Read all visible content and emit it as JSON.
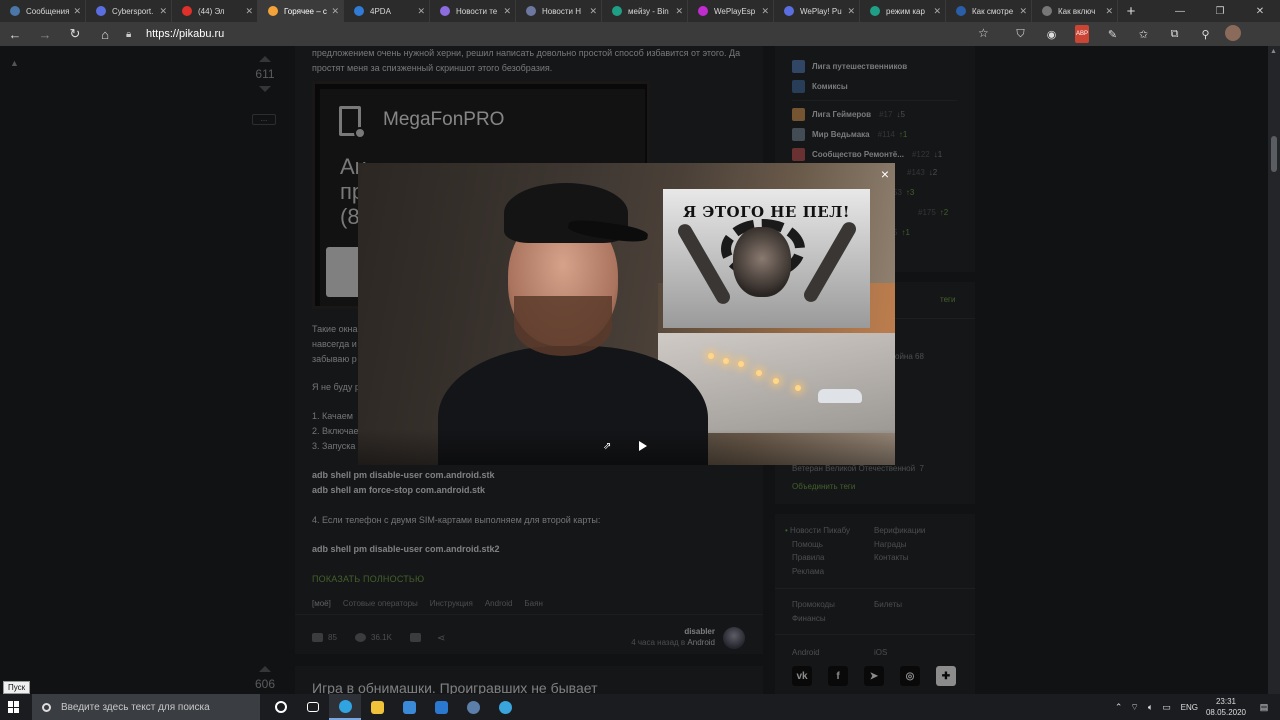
{
  "browser": {
    "tabs": [
      {
        "title": "Сообщения",
        "color": "#4a76a8",
        "active": false
      },
      {
        "title": "Cybersport.",
        "color": "#5b6ee0",
        "active": false
      },
      {
        "title": "(44) Эл",
        "color": "#e0302a",
        "active": false
      },
      {
        "title": "Горячее – с",
        "color": "#f4a23a",
        "active": true
      },
      {
        "title": "4PDA",
        "color": "#2f7bd6",
        "active": false
      },
      {
        "title": "Новости те",
        "color": "#8c6ce0",
        "active": false
      },
      {
        "title": "Новости Н",
        "color": "#6d78a0",
        "active": false
      },
      {
        "title": "мейзу - Bin",
        "color": "#1fa086",
        "active": false
      },
      {
        "title": "WePlayEsp",
        "color": "#c02cd0",
        "active": false
      },
      {
        "title": "WePlay! Pu",
        "color": "#5b6ee0",
        "active": false
      },
      {
        "title": "режим кар",
        "color": "#1fa086",
        "active": false
      },
      {
        "title": "Как смотре",
        "color": "#2a5ea8",
        "active": false
      },
      {
        "title": "Как включ",
        "color": "#777777",
        "active": false
      }
    ],
    "new_tab": "+",
    "url": "https://pikabu.ru"
  },
  "post": {
    "rating": "611",
    "lead": "предложением очень нужной херни, решил написать довольно простой способ избавится от этого. Да простят меня за спизженный скриншот этого безобразия.",
    "screenshot": {
      "app_name": "MegaFonPRO",
      "big_text": [
        "Ан",
        "пр",
        "(8"
      ]
    },
    "body_fragments": [
      "Такие окна",
      "навсегда и",
      "забываю р",
      "Я не буду р",
      "1. Качаем",
      "2. Включае",
      "3. Запуска"
    ],
    "cmd1": "adb shell pm disable-user com.android.stk",
    "cmd2": "adb shell am force-stop com.android.stk",
    "step4": "4. Если телефон с двумя SIM-картами выполняем для второй карты:",
    "cmd3": "adb shell pm disable-user com.android.stk2",
    "show_all": "ПОКАЗАТЬ ПОЛНОСТЬЮ",
    "tags": [
      "[моё]",
      "Сотовые операторы",
      "Инструкция",
      "Android",
      "Баян"
    ],
    "comments": "85",
    "views": "36.1K",
    "author": "disabler",
    "time_prefix": "4 часа назад в",
    "community": "Android"
  },
  "post2": {
    "rating": "606",
    "title": "Игра в обнимашки. Проигравших не бывает"
  },
  "sidebar": {
    "communities_top": [
      {
        "name": "Лига путешественников",
        "color": "#5a7fb8"
      },
      {
        "name": "Комиксы",
        "color": "#4a6fa0"
      }
    ],
    "communities": [
      {
        "name": "Лига Геймеров",
        "rank": "#17",
        "change": "5",
        "dir": "down",
        "color": "#d49a5a"
      },
      {
        "name": "Мир Ведьмака",
        "rank": "#114",
        "change": "1",
        "dir": "up",
        "color": "#7a8a9a"
      },
      {
        "name": "Сообщество Ремонтё...",
        "rank": "#122",
        "change": "1",
        "dir": "down",
        "color": "#c05a5a"
      }
    ],
    "hidden_ranks": [
      {
        "rank": "#143",
        "change": "2",
        "dir": "down"
      },
      {
        "rank": "53",
        "change": "3",
        "dir": "up"
      },
      {
        "rank": "#175",
        "change": "2",
        "dir": "up"
      },
      {
        "rank": "5",
        "change": "1",
        "dir": "up"
      }
    ],
    "tags_header": "теги",
    "tag_partial": "ойна 68",
    "tag_veteran": "Ветеран Великой Отечественной",
    "tag_veteran_count": "7",
    "merge_tags": "Объединить теги",
    "links_col1": [
      "Новости Пикабу",
      "Помощь",
      "Правила",
      "Реклама"
    ],
    "links_col2": [
      "Верификации",
      "Награды",
      "Контакты"
    ],
    "links_col1b": [
      "Промокоды",
      "Финансы"
    ],
    "links_col2b": [
      "Билеты"
    ],
    "apps": [
      "Android",
      "iOS"
    ],
    "social": [
      "vk-icon",
      "facebook-icon",
      "telegram-icon",
      "instagram-icon",
      "plus-icon"
    ]
  },
  "modal": {
    "meme_caption": "Я ЭТОГО НЕ ПЕЛ!",
    "close": "×"
  },
  "taskbar": {
    "start_tooltip": "Пуск",
    "search_placeholder": "Введите здесь текст для поиска",
    "lang": "ENG",
    "time": "23:31",
    "date": "08.05.2020"
  }
}
